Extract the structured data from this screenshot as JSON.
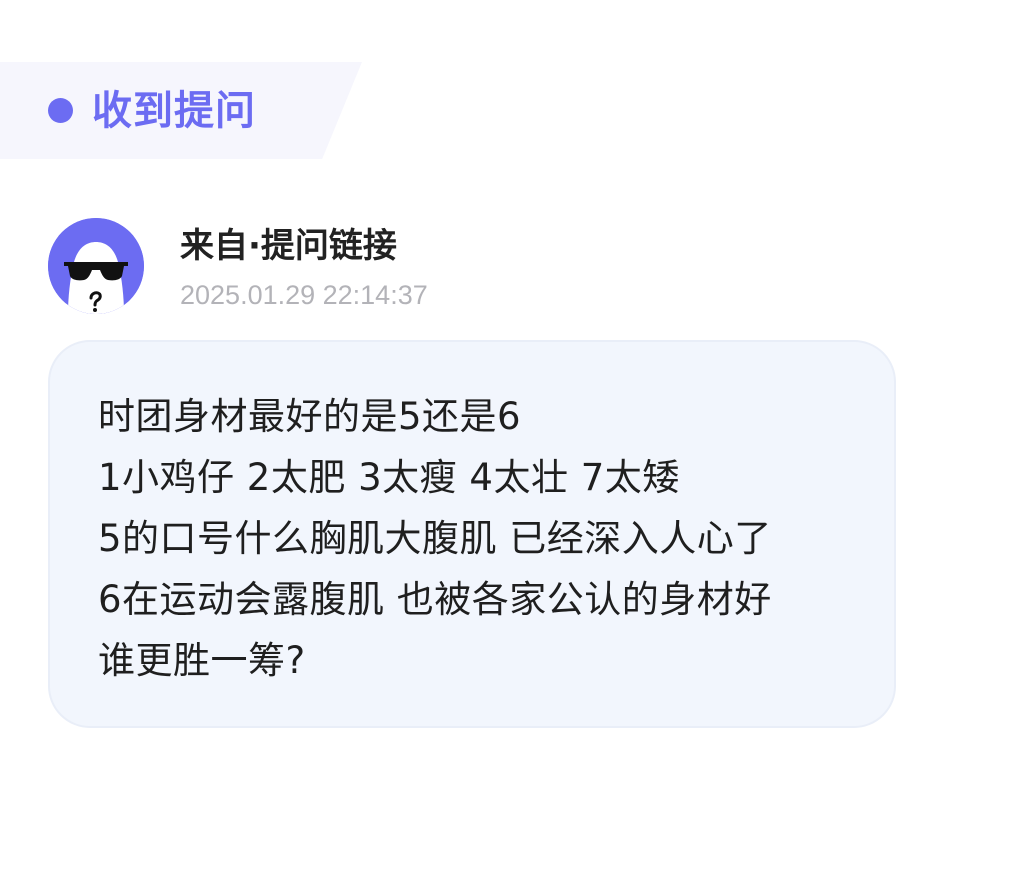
{
  "header": {
    "title": "收到提问",
    "accent_color": "#6c6cf2",
    "dot_icon": "dot-icon"
  },
  "sender": {
    "avatar_icon": "sunglasses-ghost-avatar",
    "source_label": "来自·提问链接",
    "timestamp": "2025.01.29 22:14:37"
  },
  "question": {
    "lines": [
      "时团身材最好的是5还是6",
      "1小鸡仔 2太肥 3太瘦 4太壮 7太矮",
      "5的口号什么胸肌大腹肌 已经深入人心了",
      "6在运动会露腹肌 也被各家公认的身材好",
      "谁更胜一筹?"
    ]
  }
}
